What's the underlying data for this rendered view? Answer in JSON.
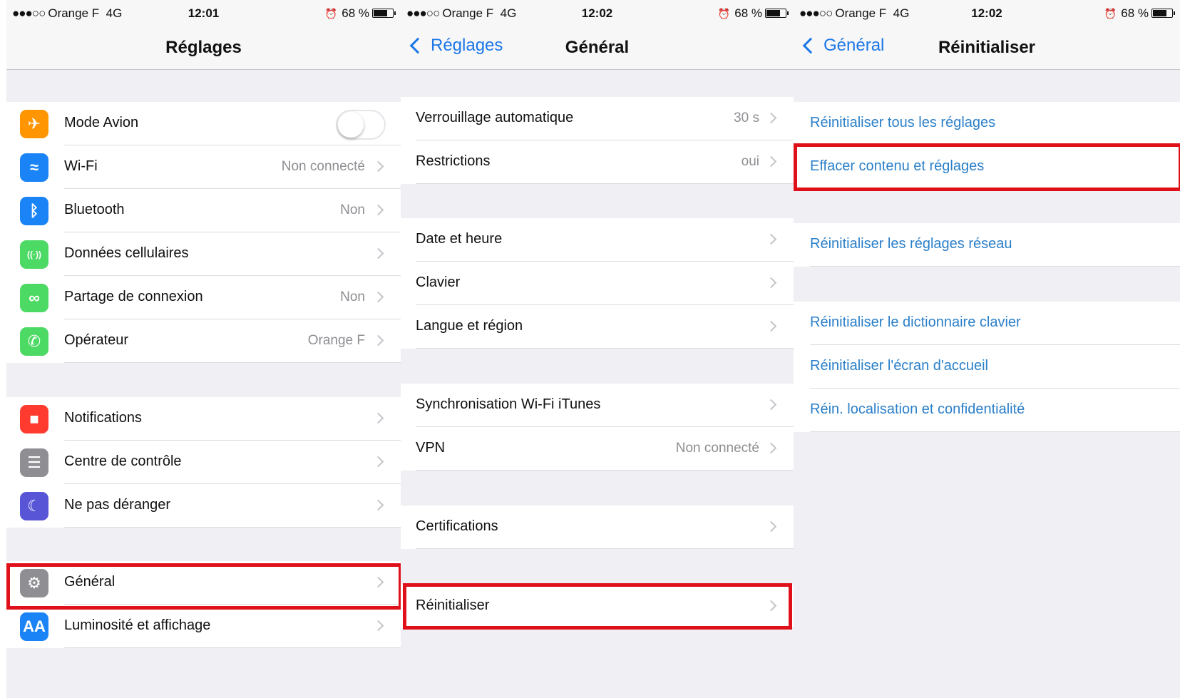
{
  "colors": {
    "accent": "#1b77e8",
    "link": "#2a7fc9",
    "highlight": "#e0101a",
    "group_bg": "#efeff4"
  },
  "screens": [
    {
      "status": {
        "signal": "●●●○○",
        "carrier": "Orange F",
        "network": "4G",
        "time": "12:01",
        "alarm_icon": "alarm-clock-icon",
        "battery": "68 %"
      },
      "nav": {
        "title": "Réglages"
      },
      "items": [
        {
          "label": "Mode Avion",
          "icon": "airplane-icon",
          "icon_color": "#ff9500",
          "icon_glyph": "✈",
          "switch_on": false
        },
        {
          "label": "Wi-Fi",
          "value": "Non connecté",
          "icon": "wifi-icon",
          "icon_color": "#1a84f6",
          "icon_glyph": "≈"
        },
        {
          "label": "Bluetooth",
          "value": "Non",
          "icon": "bluetooth-icon",
          "icon_color": "#1a84f6",
          "icon_glyph": "ᛒ"
        },
        {
          "label": "Données cellulaires",
          "value": "",
          "icon": "cellular-icon",
          "icon_color": "#4cd964",
          "icon_glyph": "((·))"
        },
        {
          "label": "Partage de connexion",
          "value": "Non",
          "icon": "hotspot-icon",
          "icon_color": "#4cd964",
          "icon_glyph": "∞"
        },
        {
          "label": "Opérateur",
          "value": "Orange F",
          "icon": "phone-icon",
          "icon_color": "#4cd964",
          "icon_glyph": "✆"
        },
        {
          "label": "Notifications",
          "value": "",
          "icon": "notifications-icon",
          "icon_color": "#ff3b30",
          "icon_glyph": "■"
        },
        {
          "label": "Centre de contrôle",
          "value": "",
          "icon": "control-center-icon",
          "icon_color": "#8e8e93",
          "icon_glyph": "☰"
        },
        {
          "label": "Ne pas déranger",
          "value": "",
          "icon": "moon-icon",
          "icon_color": "#5856d6",
          "icon_glyph": "☾"
        },
        {
          "label": "Général",
          "value": "",
          "icon": "gear-icon",
          "icon_color": "#8e8e93",
          "icon_glyph": "⚙"
        },
        {
          "label": "Luminosité et affichage",
          "value": "",
          "icon": "brightness-icon",
          "icon_color": "#1a84f6",
          "icon_glyph": "AA"
        }
      ]
    },
    {
      "status": {
        "signal": "●●●○○",
        "carrier": "Orange F",
        "network": "4G",
        "time": "12:02",
        "alarm_icon": "alarm-clock-icon",
        "battery": "68 %"
      },
      "nav": {
        "back": "Réglages",
        "title": "Général"
      },
      "items": [
        {
          "label": "Verrouillage automatique",
          "value": "30 s"
        },
        {
          "label": "Restrictions",
          "value": "oui"
        },
        {
          "label": "Date et heure",
          "value": ""
        },
        {
          "label": "Clavier",
          "value": ""
        },
        {
          "label": "Langue et région",
          "value": ""
        },
        {
          "label": "Synchronisation Wi-Fi iTunes",
          "value": ""
        },
        {
          "label": "VPN",
          "value": "Non connecté"
        },
        {
          "label": "Certifications",
          "value": ""
        },
        {
          "label": "Réinitialiser",
          "value": ""
        }
      ]
    },
    {
      "status": {
        "signal": "●●●○○",
        "carrier": "Orange F",
        "network": "4G",
        "time": "12:02",
        "alarm_icon": "alarm-clock-icon",
        "battery": "68 %"
      },
      "nav": {
        "back": "Général",
        "title": "Réinitialiser"
      },
      "items": [
        {
          "label": "Réinitialiser tous les réglages"
        },
        {
          "label": "Effacer contenu et réglages"
        },
        {
          "label": "Réinitialiser les réglages réseau"
        },
        {
          "label": "Réinitialiser le dictionnaire clavier"
        },
        {
          "label": "Réinitialiser l'écran d'accueil"
        },
        {
          "label": "Réin. localisation et confidentialité"
        }
      ]
    }
  ]
}
